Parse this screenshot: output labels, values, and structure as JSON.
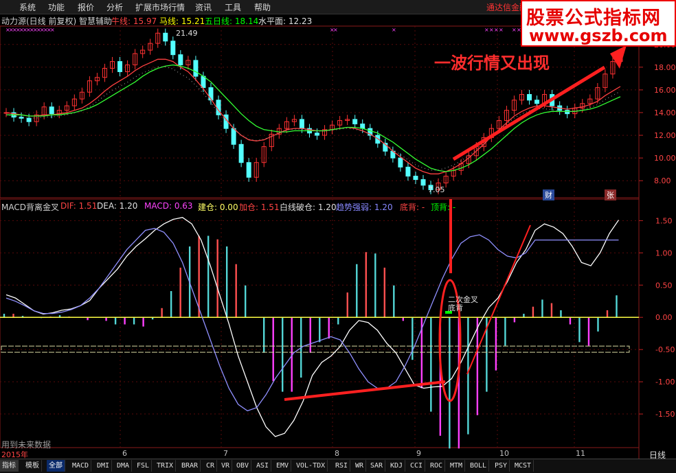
{
  "menu": [
    "系统",
    "功能",
    "报价",
    "分析",
    "扩展市场行情",
    "资讯",
    "工具",
    "帮助"
  ],
  "app_title": "通达信金融",
  "watermark": {
    "line1": "股票公式指标网",
    "line2": "www.gszb.com"
  },
  "main_header": {
    "name": "动力源(日线 前复权) 智慧辅助",
    "ma1_label": "牛线: 15.97",
    "ma2_label": "马线: 15.21",
    "ma3_label": "五日线: 18.14",
    "ma4_label": "水平面: 12.23"
  },
  "macd_header": {
    "name": "MACD背离金叉",
    "dif": "DIF: 1.51",
    "dea": "DEA: 1.20",
    "macd": "MACD: 0.63",
    "jiancang": "建仓: 0.00",
    "jiacang": "加仓: 1.51",
    "baixian": "白线破仓: 1.20",
    "qushi": "趋势强弱: 1.20",
    "didi": "底背: -",
    "dingbei": "顶背: -"
  },
  "annotation": "一波行情又出现",
  "annotation_small": "二次金叉",
  "annotation_small2": "底背",
  "price_high_label": "21.49",
  "price_low_label": "7.05",
  "badge_cai": "财",
  "badge_zhang": "张",
  "future_data_note": "用到未来数据",
  "period": "日线",
  "colors": {
    "up": "#ff3232",
    "down": "#54ffff",
    "ma_green": "#00ff00",
    "dea": "#9090ff",
    "bg": "#000000"
  },
  "chart_data": [
    {
      "type": "line",
      "title": "动力源(日线 前复权)",
      "x_labels": [
        "2015年",
        "6",
        "7",
        "8",
        "9",
        "10",
        "11"
      ],
      "yticks": [
        "20.00",
        "18.00",
        "16.00",
        "14.00",
        "12.00",
        "10.00",
        "8.00"
      ],
      "ylim": [
        6.5,
        21.5
      ],
      "series": [
        {
          "name": "收盘",
          "values": [
            14,
            13.6,
            13.5,
            13.2,
            13.8,
            14.5,
            13.9,
            14.2,
            14.6,
            15.2,
            15.8,
            16.8,
            17.1,
            17.9,
            18.5,
            17.6,
            18.2,
            19.2,
            19.5,
            20.1,
            21.0,
            20.3,
            19.1,
            18.2,
            18.6,
            17.2,
            16.2,
            15.1,
            13.8,
            12.6,
            11.2,
            9.6,
            8.3,
            9.6,
            11.0,
            12.1,
            12.6,
            13.2,
            13.4,
            12.6,
            12.2,
            12.0,
            12.5,
            12.9,
            13.3,
            13.4,
            13.0,
            12.6,
            12.0,
            11.3,
            10.6,
            10.0,
            9.2,
            8.4,
            8.1,
            7.6,
            7.2,
            7.8,
            8.4,
            8.9,
            9.5,
            10.2,
            11.0,
            11.8,
            12.6,
            13.3,
            14.2,
            15.1,
            15.6,
            15.1,
            14.8,
            15.6,
            14.6,
            14.2,
            13.9,
            14.4,
            14.8,
            15.2,
            16.2,
            17.4,
            18.5,
            19.1
          ]
        },
        {
          "name": "牛线",
          "values": [
            14.0,
            13.9,
            13.8,
            13.7,
            13.7,
            13.8,
            13.8,
            13.9,
            14.0,
            14.2,
            14.4,
            14.8,
            15.3,
            15.9,
            16.4,
            16.8,
            17.2,
            17.7,
            18.1,
            18.4,
            18.7,
            18.7,
            18.5,
            18.0,
            17.6,
            16.9,
            16.1,
            15.2,
            14.2,
            13.4,
            12.6,
            12.0,
            11.6,
            11.5,
            11.6,
            11.9,
            12.2,
            12.5,
            12.6,
            12.6,
            12.5,
            12.4,
            12.4,
            12.5,
            12.6,
            12.7,
            12.6,
            12.4,
            12.1,
            11.7,
            11.2,
            10.6,
            10.1,
            9.6,
            9.1,
            8.8,
            8.6,
            8.6,
            8.8,
            9.1,
            9.5,
            10.0,
            10.6,
            11.2,
            11.9,
            12.5,
            13.1,
            13.7,
            14.1,
            14.4,
            14.6,
            14.6,
            14.5,
            14.4,
            14.3,
            14.4,
            14.5,
            14.7,
            15.0,
            15.5,
            15.9,
            16.3
          ]
        },
        {
          "name": "马线",
          "values": [
            13.8,
            13.8,
            13.8,
            13.7,
            13.7,
            13.7,
            13.8,
            13.8,
            13.9,
            14.0,
            14.2,
            14.4,
            14.7,
            15.1,
            15.5,
            15.9,
            16.3,
            16.7,
            17.2,
            17.6,
            17.9,
            18.1,
            18.2,
            18.1,
            17.9,
            17.6,
            17.2,
            16.7,
            16.0,
            15.3,
            14.6,
            13.9,
            13.3,
            12.8,
            12.5,
            12.4,
            12.3,
            12.3,
            12.4,
            12.4,
            12.4,
            12.4,
            12.4,
            12.5,
            12.6,
            12.7,
            12.7,
            12.6,
            12.4,
            12.2,
            11.8,
            11.4,
            10.9,
            10.4,
            9.9,
            9.5,
            9.1,
            8.9,
            8.8,
            8.9,
            9.1,
            9.4,
            9.8,
            10.3,
            10.8,
            11.4,
            12.0,
            12.6,
            13.1,
            13.5,
            13.8,
            14.0,
            14.1,
            14.1,
            14.1,
            14.1,
            14.2,
            14.3,
            14.5,
            14.8,
            15.1,
            15.4
          ]
        }
      ]
    },
    {
      "type": "bar",
      "title": "MACD背离金叉",
      "yticks": [
        "1.50",
        "1.00",
        "0.50",
        "0.00",
        "-0.50",
        "-1.00",
        "-1.50"
      ],
      "ylim": [
        -2.0,
        1.6
      ],
      "series": [
        {
          "name": "DIF",
          "values": [
            0.35,
            0.3,
            0.2,
            0.1,
            0.05,
            0.07,
            0.11,
            0.13,
            0.18,
            0.26,
            0.45,
            0.6,
            0.75,
            0.95,
            1.1,
            1.22,
            1.35,
            1.45,
            1.52,
            1.55,
            1.45,
            1.2,
            0.8,
            0.35,
            -0.1,
            -0.6,
            -1.0,
            -1.4,
            -1.7,
            -1.85,
            -1.8,
            -1.6,
            -1.3,
            -0.9,
            -0.7,
            -0.6,
            -0.45,
            -0.2,
            -0.05,
            -0.08,
            -0.2,
            -0.4,
            -0.55,
            -0.8,
            -1.05,
            -1.1,
            -1.08,
            -1.07,
            -0.95,
            -0.7,
            -0.4,
            -0.1,
            0.15,
            0.3,
            0.55,
            0.85,
            1.05,
            1.35,
            1.45,
            1.4,
            1.3,
            1.1,
            0.85,
            0.8,
            1.0,
            1.3,
            1.51
          ]
        },
        {
          "name": "DEA",
          "values": [
            0.3,
            0.25,
            0.18,
            0.1,
            0.06,
            0.06,
            0.08,
            0.12,
            0.18,
            0.3,
            0.45,
            0.65,
            0.85,
            1.05,
            1.2,
            1.35,
            1.38,
            1.32,
            1.15,
            0.85,
            0.45,
            0.05,
            -0.35,
            -0.75,
            -1.1,
            -1.35,
            -1.45,
            -1.4,
            -1.2,
            -0.95,
            -0.75,
            -0.55,
            -0.45,
            -0.4,
            -0.35,
            -0.3,
            -0.35,
            -0.55,
            -0.8,
            -1.0,
            -1.1,
            -1.1,
            -1.0,
            -0.75,
            -0.45,
            -0.1,
            0.25,
            0.6,
            0.9,
            1.15,
            1.25,
            1.28,
            1.2,
            1.05,
            0.95,
            0.92,
            1.0,
            1.2
          ]
        }
      ]
    }
  ],
  "tabs": [
    "指标",
    "模板",
    "全部",
    "MACD",
    "DMI",
    "DMA",
    "FSL",
    "TRIX",
    "BRAR",
    "CR",
    "VR",
    "OBV",
    "ASI",
    "EMV",
    "VOL-TDX",
    "RSI",
    "WR",
    "SAR",
    "KDJ",
    "CCI",
    "ROC",
    "MTM",
    "BOLL",
    "PSY",
    "MCST"
  ],
  "tab_year": "2015年",
  "tab_months": [
    "6",
    "7",
    "8",
    "9",
    "10",
    "11"
  ]
}
